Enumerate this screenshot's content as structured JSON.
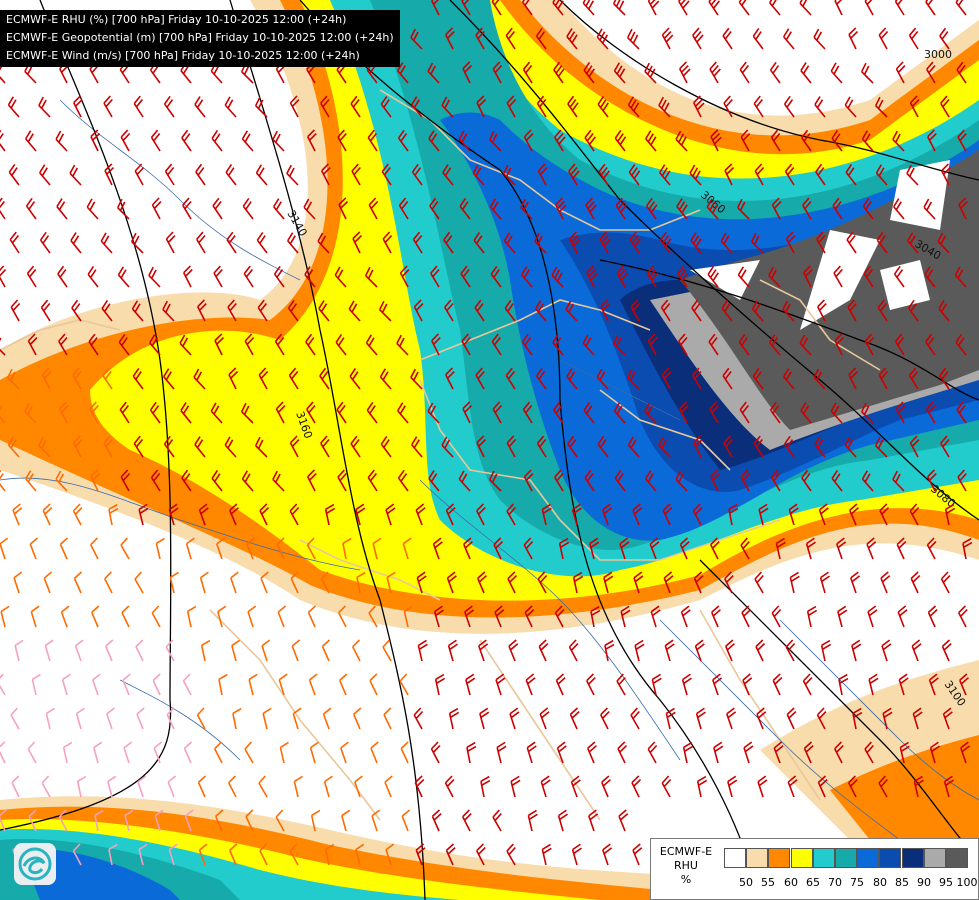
{
  "header": {
    "lines": [
      "ECMWF-E RHU (%) [700 hPa] Friday 10-10-2025 12:00 (+24h)",
      "ECMWF-E Geopotential (m) [700 hPa] Friday 10-10-2025 12:00 (+24h)",
      "ECMWF-E Wind (m/s) [700 hPa] Friday 10-10-2025 12:00 (+24h)"
    ]
  },
  "contours": {
    "labels": [
      "3000",
      "3060",
      "3040",
      "3140",
      "3160",
      "3080",
      "3100"
    ]
  },
  "legend": {
    "title_lines": [
      "ECMWF-E",
      "RHU",
      "%"
    ],
    "ticks": [
      "50",
      "55",
      "60",
      "65",
      "70",
      "75",
      "80",
      "85",
      "90",
      "95",
      "100"
    ],
    "colors": [
      "#ffffff",
      "#f8dcac",
      "#ff8800",
      "#ffff00",
      "#22cccc",
      "#16aaaa",
      "#0a6ad8",
      "#0a4cb0",
      "#0a2e7a",
      "#aaaaaa",
      "#5a5a5a"
    ]
  },
  "colors": {
    "wind_barb_red": "#cc0000",
    "wind_barb_orange": "#ff6a00",
    "wind_barb_pink": "#f5a0c0",
    "border_tan": "#e8c89a",
    "river_blue": "#3a6aaa",
    "contour": "#000000"
  }
}
